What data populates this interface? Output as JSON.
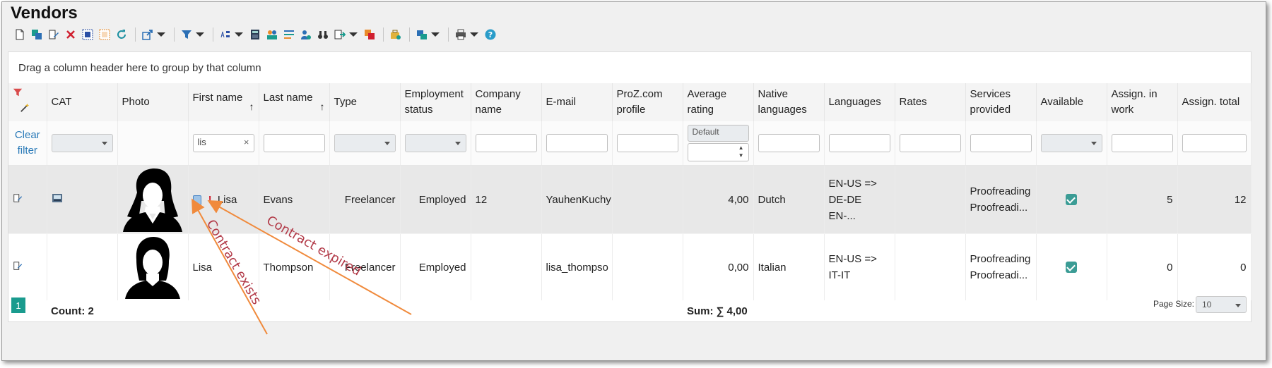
{
  "window": {
    "title": "Vendors"
  },
  "grid": {
    "group_hint": "Drag a column header here to group by that column",
    "columns": {
      "cat": "CAT",
      "photo": "Photo",
      "first_name": "First name",
      "last_name": "Last name",
      "type": "Type",
      "employment_status": "Employment status",
      "company_name": "Company name",
      "email": "E-mail",
      "proz": "ProZ.com profile",
      "avg_rating": "Average rating",
      "native_languages": "Native languages",
      "languages": "Languages",
      "rates": "Rates",
      "services": "Services provided",
      "available": "Available",
      "assign_in_work": "Assign. in work",
      "assign_total": "Assign. total"
    },
    "filter": {
      "clear_filter": "Clear filter",
      "first_name_value": "lis",
      "rating_mode": "Default"
    },
    "rows": [
      {
        "first_name": "Lisa",
        "last_name": "Evans",
        "type": "Freelancer",
        "employment_status": "Employed",
        "company_name": "12",
        "email": "YauhenKuchy",
        "avg_rating": "4,00",
        "native_languages": "Dutch",
        "languages_1": "EN-US =>",
        "languages_2": "DE-DE EN-...",
        "services_1": "Proofreading",
        "services_2": "Proofreadi...",
        "assign_in_work": "5",
        "assign_total": "12"
      },
      {
        "first_name": "Lisa",
        "last_name": "Thompson",
        "type": "Freelancer",
        "employment_status": "Employed",
        "company_name": "",
        "email": "lisa_thompso",
        "avg_rating": "0,00",
        "native_languages": "Italian",
        "languages_1": "EN-US =>",
        "languages_2": "IT-IT",
        "services_1": "Proofreading",
        "services_2": "Proofreadi...",
        "assign_in_work": "0",
        "assign_total": "0"
      }
    ],
    "footer": {
      "count": "Count: 2",
      "sum": "Sum: ∑ 4,00"
    },
    "pager": {
      "current_page": "1",
      "page_size_label": "Page Size:",
      "page_size": "10"
    }
  },
  "annotations": {
    "contract_exists": "Contract exists",
    "contract_expired": "Contract expired"
  },
  "colors": {
    "accent": "#1a9b8e",
    "annotation_arrow": "#f08a3c",
    "annotation_text": "#b23a48",
    "link": "#2a7ab8"
  }
}
